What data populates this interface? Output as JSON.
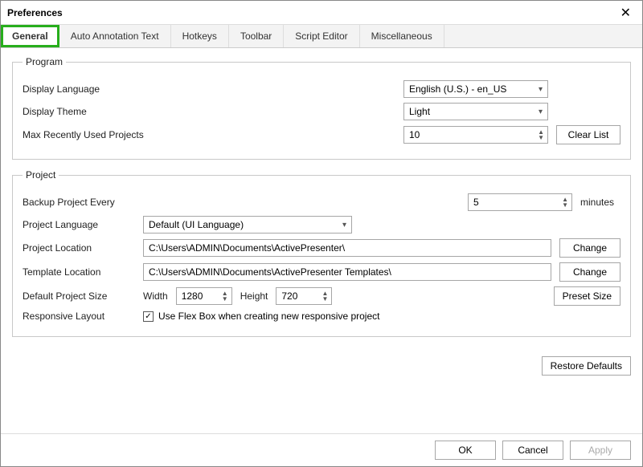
{
  "window": {
    "title": "Preferences"
  },
  "tabs": {
    "general": "General",
    "auto_annotation": "Auto Annotation Text",
    "hotkeys": "Hotkeys",
    "toolbar": "Toolbar",
    "script_editor": "Script Editor",
    "miscellaneous": "Miscellaneous"
  },
  "program": {
    "legend": "Program",
    "display_language_label": "Display Language",
    "display_language_value": "English (U.S.) - en_US",
    "display_theme_label": "Display Theme",
    "display_theme_value": "Light",
    "max_recent_label": "Max Recently Used Projects",
    "max_recent_value": "10",
    "clear_list_btn": "Clear List"
  },
  "project": {
    "legend": "Project",
    "backup_label": "Backup Project Every",
    "backup_value": "5",
    "backup_unit": "minutes",
    "lang_label": "Project Language",
    "lang_value": "Default (UI Language)",
    "location_label": "Project Location",
    "location_value": "C:\\Users\\ADMIN\\Documents\\ActivePresenter\\",
    "template_label": "Template Location",
    "template_value": "C:\\Users\\ADMIN\\Documents\\ActivePresenter Templates\\",
    "change_btn": "Change",
    "default_size_label": "Default Project Size",
    "width_label": "Width",
    "width_value": "1280",
    "height_label": "Height",
    "height_value": "720",
    "preset_size_btn": "Preset Size",
    "responsive_label": "Responsive Layout",
    "responsive_checkbox_label": "Use Flex Box when creating new responsive project",
    "responsive_checked": "✓"
  },
  "buttons": {
    "restore_defaults": "Restore Defaults",
    "ok": "OK",
    "cancel": "Cancel",
    "apply": "Apply"
  }
}
